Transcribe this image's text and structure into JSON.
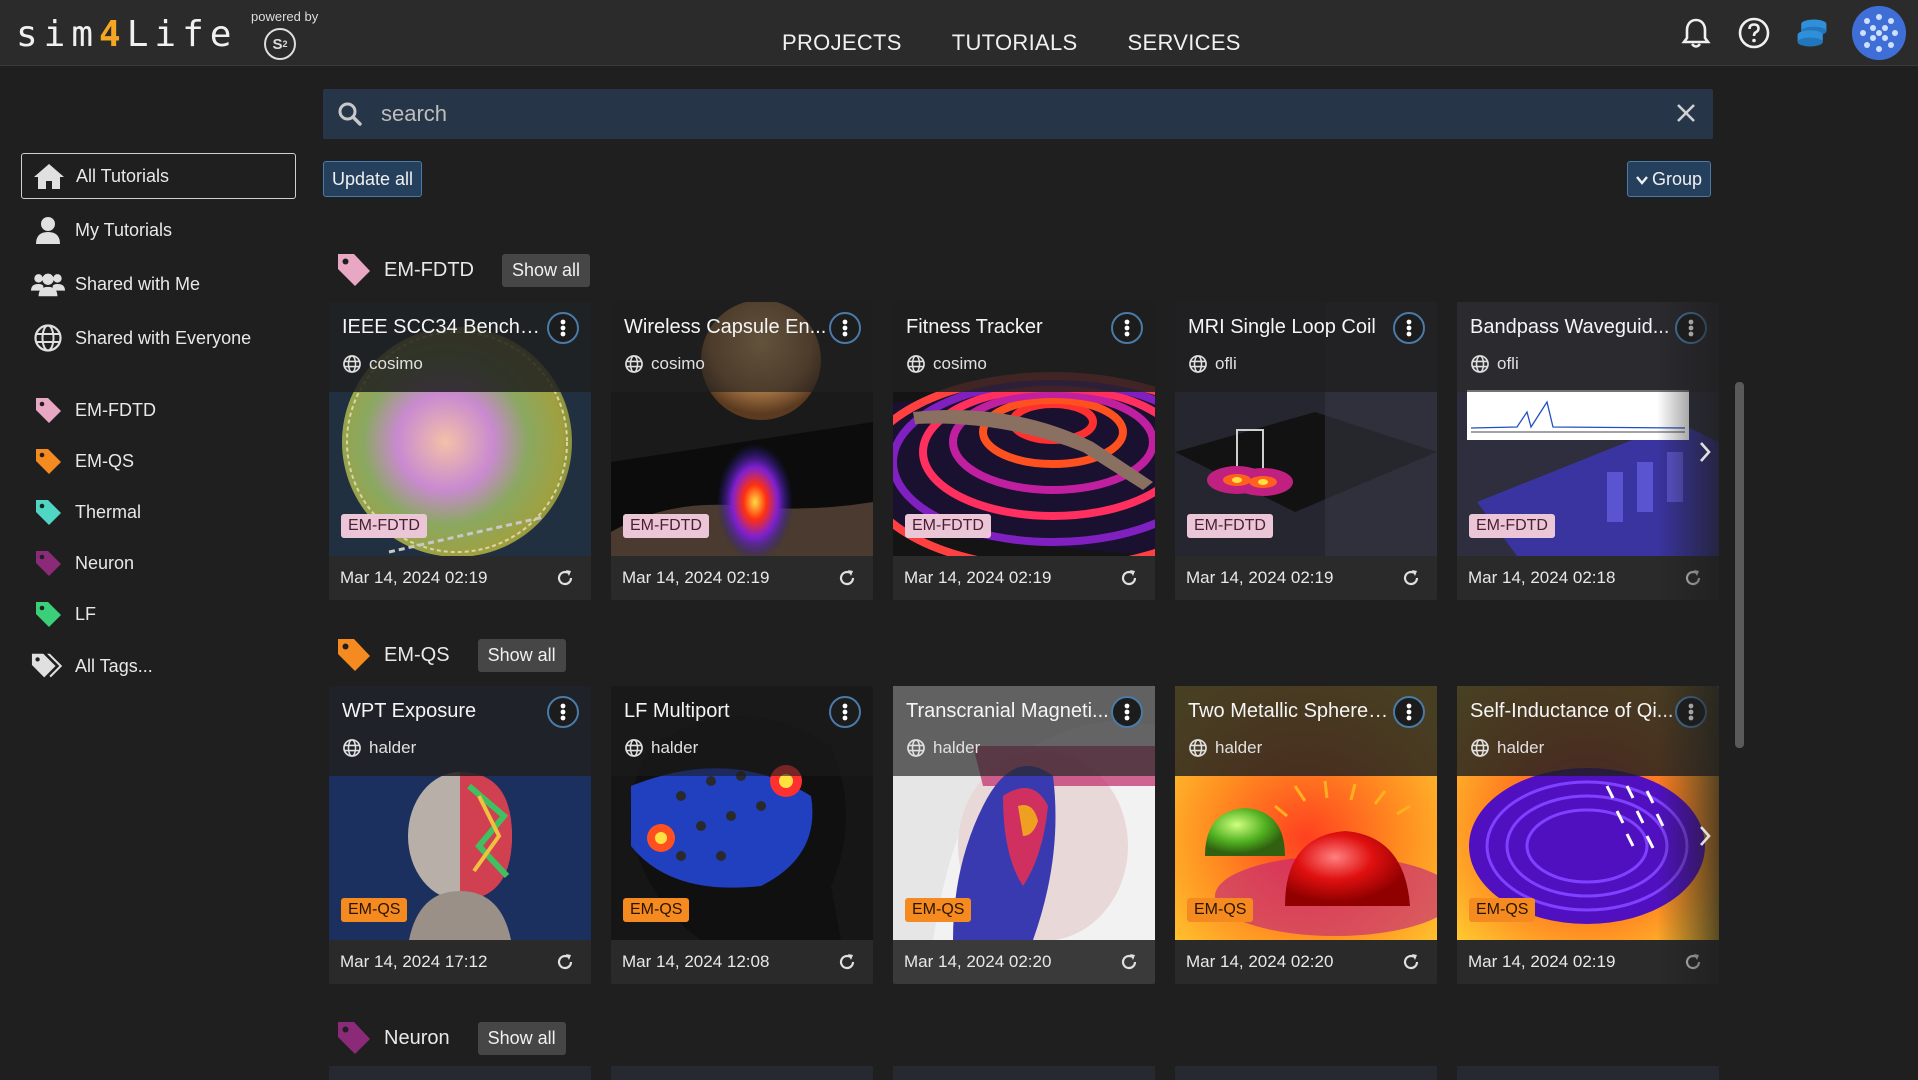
{
  "header": {
    "logo_text_a": "sim",
    "logo_text_b": "4",
    "logo_text_c": "Life",
    "powered_by": "powered by",
    "s4_mark": "S",
    "nav": [
      "PROJECTS",
      "TUTORIALS",
      "SERVICES"
    ]
  },
  "search": {
    "placeholder": "search"
  },
  "toolbar": {
    "update_all": "Update all",
    "group": "Group"
  },
  "sidebar": {
    "items": [
      {
        "label": "All Tutorials"
      },
      {
        "label": "My Tutorials"
      },
      {
        "label": "Shared with Me"
      },
      {
        "label": "Shared with Everyone"
      }
    ],
    "tags": [
      {
        "label": "EM-FDTD",
        "color": "#e8a8c4"
      },
      {
        "label": "EM-QS",
        "color": "#f48a20"
      },
      {
        "label": "Thermal",
        "color": "#4fd6c4"
      },
      {
        "label": "Neuron",
        "color": "#8a2a78"
      },
      {
        "label": "LF",
        "color": "#3ccf7a"
      }
    ],
    "all_tags": "All Tags..."
  },
  "sections": [
    {
      "title": "EM-FDTD",
      "show_all": "Show all",
      "cards": [
        {
          "title": "IEEE SCC34 Benchm...",
          "owner": "cosimo",
          "tag": "EM-FDTD",
          "date": "Mar 14, 2024 02:19"
        },
        {
          "title": "Wireless Capsule En...",
          "owner": "cosimo",
          "tag": "EM-FDTD",
          "date": "Mar 14, 2024 02:19"
        },
        {
          "title": "Fitness Tracker",
          "owner": "cosimo",
          "tag": "EM-FDTD",
          "date": "Mar 14, 2024 02:19"
        },
        {
          "title": "MRI Single Loop Coil",
          "owner": "ofli",
          "tag": "EM-FDTD",
          "date": "Mar 14, 2024 02:19"
        },
        {
          "title": "Bandpass Waveguid...",
          "owner": "ofli",
          "tag": "EM-FDTD",
          "date": "Mar 14, 2024 02:18"
        }
      ]
    },
    {
      "title": "EM-QS",
      "show_all": "Show all",
      "cards": [
        {
          "title": "WPT Exposure",
          "owner": "halder",
          "tag": "EM-QS",
          "date": "Mar 14, 2024 17:12"
        },
        {
          "title": "LF Multiport",
          "owner": "halder",
          "tag": "EM-QS",
          "date": "Mar 14, 2024 12:08"
        },
        {
          "title": "Transcranial Magneti...",
          "owner": "halder",
          "tag": "EM-QS",
          "date": "Mar 14, 2024 02:20"
        },
        {
          "title": "Two Metallic Spheres...",
          "owner": "halder",
          "tag": "EM-QS",
          "date": "Mar 14, 2024 02:20"
        },
        {
          "title": "Self-Inductance of Qi...",
          "owner": "halder",
          "tag": "EM-QS",
          "date": "Mar 14, 2024 02:19"
        }
      ]
    },
    {
      "title": "Neuron",
      "show_all": "Show all"
    }
  ]
}
